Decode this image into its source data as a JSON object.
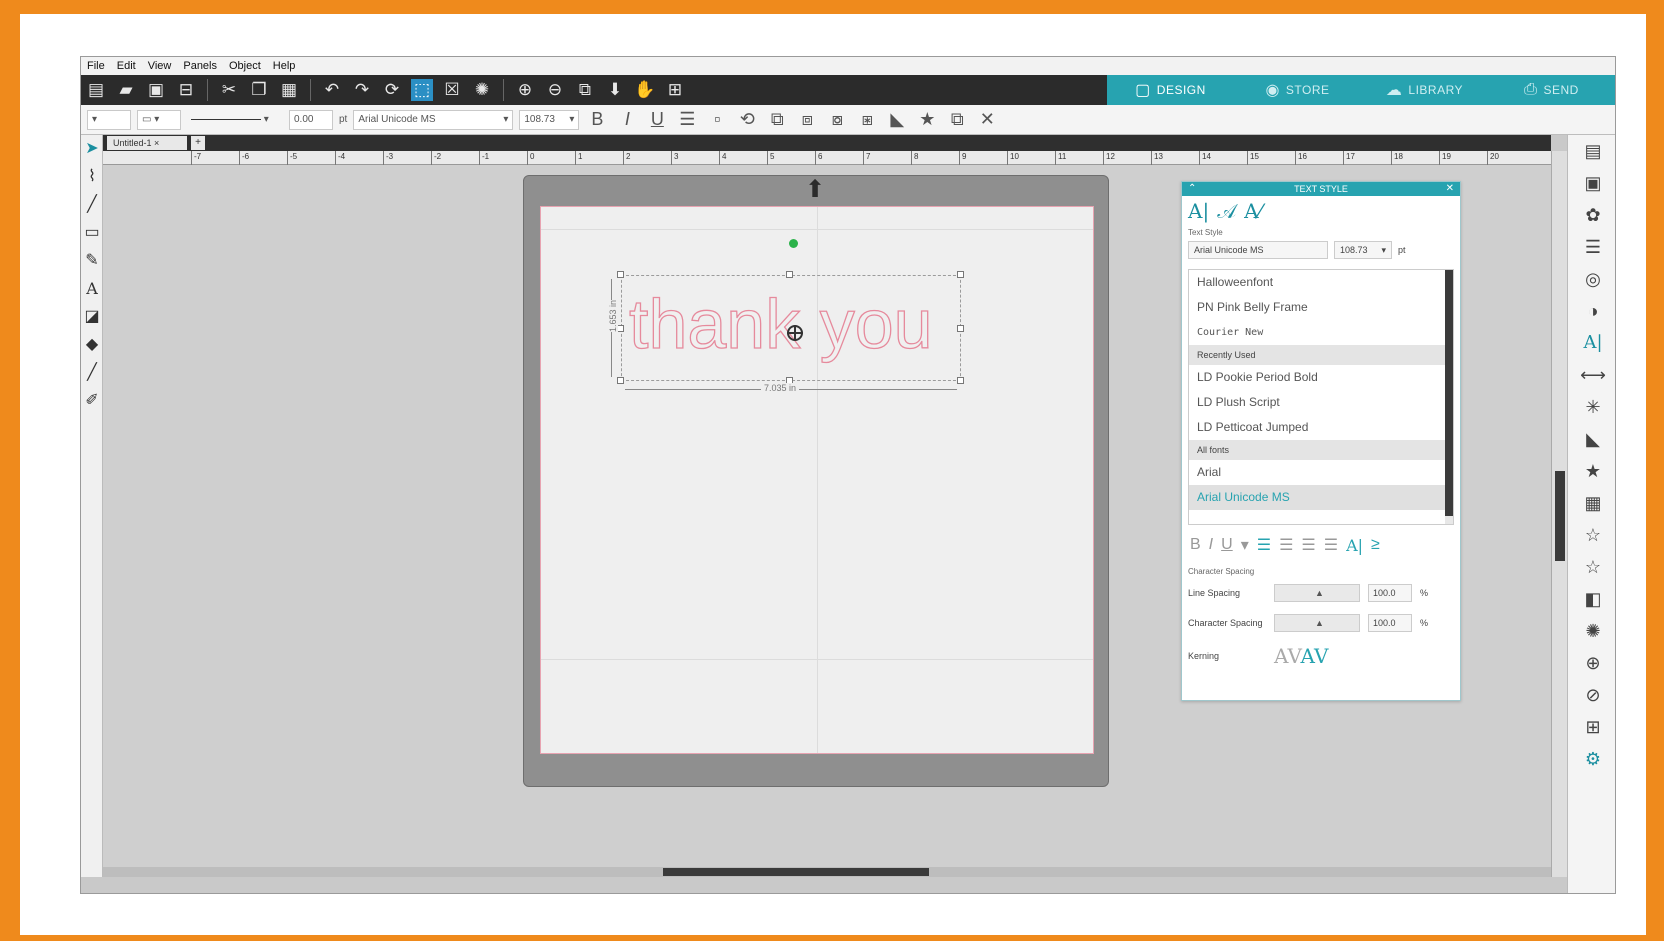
{
  "menu": [
    "File",
    "Edit",
    "View",
    "Panels",
    "Object",
    "Help"
  ],
  "toolbar_icons": [
    "new-icon",
    "open-icon",
    "save-icon",
    "print-icon",
    "cut-icon",
    "copy-icon",
    "paste-icon",
    "undo-icon",
    "redo-icon",
    "refresh-icon",
    "select-icon",
    "deselect-icon",
    "pan-select-icon",
    "zoom-in-icon",
    "zoom-out-icon",
    "zoom-fit-icon",
    "move-down-icon",
    "hand-icon",
    "grid-icon"
  ],
  "mode_tabs": [
    {
      "label": "DESIGN",
      "icon": "design-icon"
    },
    {
      "label": "STORE",
      "icon": "store-icon"
    },
    {
      "label": "LIBRARY",
      "icon": "library-icon"
    },
    {
      "label": "SEND",
      "icon": "send-icon"
    }
  ],
  "propbar": {
    "line_width": "0.00",
    "line_unit": "pt",
    "font_name": "Arial Unicode MS",
    "font_size": "108.73"
  },
  "document_tab": "Untitled-1",
  "ruler_ticks": [
    "-7",
    "-6",
    "-5",
    "-4",
    "-3",
    "-2",
    "-1",
    "0",
    "1",
    "2",
    "3",
    "4",
    "5",
    "6",
    "7",
    "8",
    "9",
    "10",
    "11",
    "12",
    "13",
    "14",
    "15",
    "16",
    "17",
    "18",
    "19",
    "20"
  ],
  "canvas": {
    "text": "thank you",
    "width_label": "7.035 in",
    "height_label": "1.653 in"
  },
  "text_style_panel": {
    "title": "TEXT STYLE",
    "tab_labels": [
      "A|",
      "𝒜",
      "A⁄"
    ],
    "section_text_style": "Text Style",
    "font_name": "Arial Unicode MS",
    "font_size": "108.73",
    "font_unit": "pt",
    "fonts_top": [
      "Halloweenfont",
      "PN Pink Belly Frame",
      "Courier New"
    ],
    "recently_used_header": "Recently Used",
    "recently_used": [
      "LD Pookie Period Bold",
      "LD Plush Script",
      "LD Petticoat Jumped"
    ],
    "all_fonts_header": "All fonts",
    "all_fonts": [
      "Arial",
      "Arial Unicode MS"
    ],
    "selected_font": "Arial Unicode MS",
    "section_char_spacing": "Character Spacing",
    "line_spacing_label": "Line Spacing",
    "line_spacing_value": "100.0",
    "char_spacing_label": "Character Spacing",
    "char_spacing_value": "100.0",
    "percent": "%",
    "kerning_label": "Kerning"
  },
  "colors": {
    "frame": "#ef8a1c",
    "accent": "#27a3b0",
    "toolbar": "#2b2b2b",
    "text_outline": "#e68a9c"
  }
}
